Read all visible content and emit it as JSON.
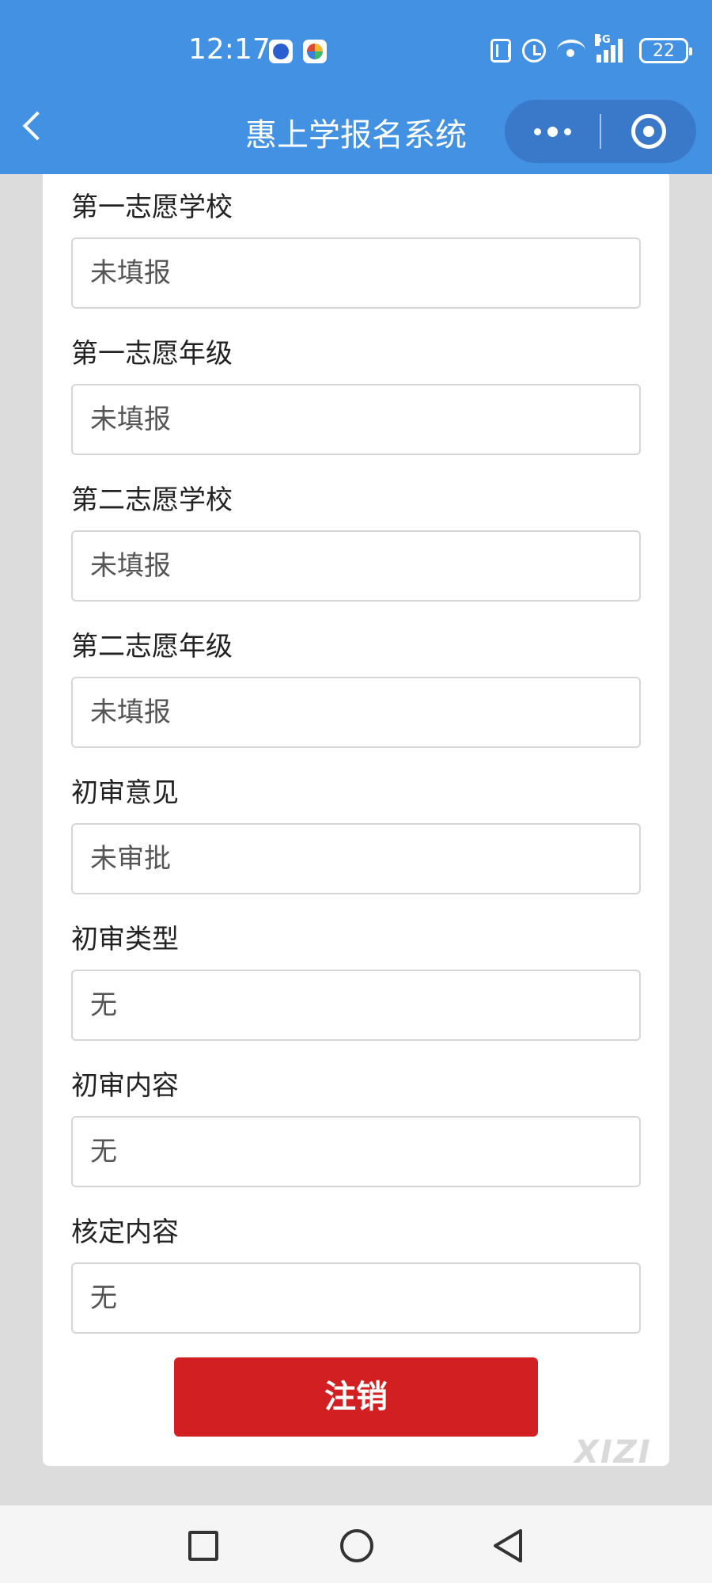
{
  "status_bar": {
    "time": "12:17",
    "signal_label": "5G",
    "battery": "22",
    "icons": [
      "app-icon-1",
      "app-icon-2",
      "nfc-icon",
      "alarm-icon",
      "wifi-icon",
      "signal-icon",
      "battery-icon"
    ]
  },
  "nav_bar": {
    "title": "惠上学报名系统",
    "icons": [
      "back-icon",
      "more-icon",
      "close-mini-program-icon"
    ],
    "background": "#4391e3"
  },
  "form": {
    "fields": [
      {
        "label": "第一志愿学校",
        "value": "未填报"
      },
      {
        "label": "第一志愿年级",
        "value": "未填报"
      },
      {
        "label": "第二志愿学校",
        "value": "未填报"
      },
      {
        "label": "第二志愿年级",
        "value": "未填报"
      },
      {
        "label": "初审意见",
        "value": "未审批"
      },
      {
        "label": "初审类型",
        "value": "无"
      },
      {
        "label": "初审内容",
        "value": "无"
      },
      {
        "label": "核定内容",
        "value": "无"
      }
    ],
    "logout_label": "注销",
    "logout_color": "#d21f21"
  },
  "watermark": "XIZI",
  "system_nav": {
    "icons": [
      "recents-square-icon",
      "home-circle-icon",
      "back-triangle-icon"
    ]
  }
}
